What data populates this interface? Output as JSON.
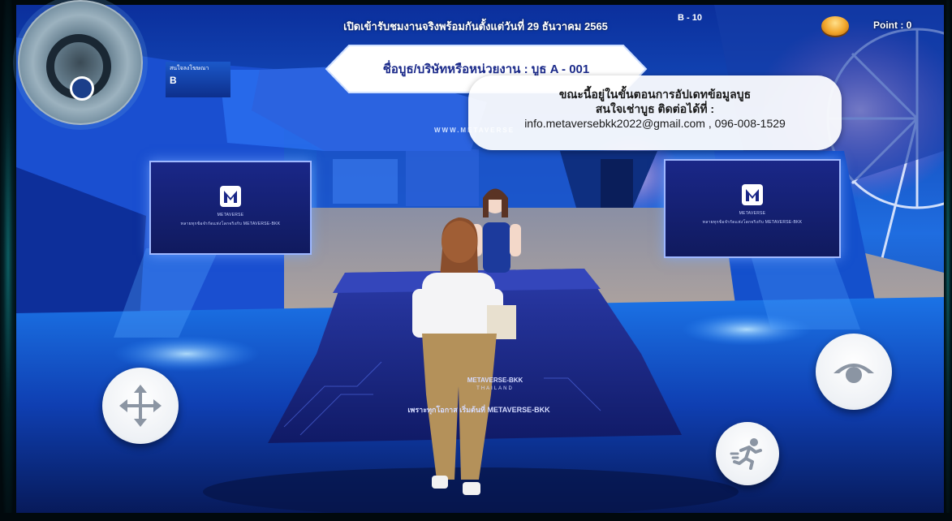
{
  "hud": {
    "top_banner": "เปิดเข้ารับชมงานจริงพร้อมกันตั้งแต่วันที่ 29 ธันวาคม 2565",
    "booth_name": "ชื่อบูธ/บริษัทหรือหน่วยงาน : บูธ A - 001",
    "notice_line1": "ขณะนี้อยู่ในขั้นตอนการอัปเดทข้อมูลบูธ",
    "notice_line2": "สนใจเช่าบูธ ติดต่อได้ที่ :",
    "notice_line3": "info.metaversebkk2022@gmail.com , 096-008-1529",
    "points_label": "Point : 0"
  },
  "scene": {
    "website_text": "WWW.METAVERSE",
    "side_sign_small": "สนใจลงโฆษณา",
    "side_sign_big": "B",
    "right_top_sign": "B - 10",
    "screen_caption_1": "METAVERSE",
    "screen_caption_2": "ทลายทุกข้อจำกัดแห่งโลกจริงกับ METAVERSE-BKK",
    "counter_brand": "METAVERSE-BKK",
    "counter_sub": "THAILAND",
    "counter_tagline": "เพราะทุกโอกาส เริ่มต้นที่ METAVERSE-BKK"
  },
  "controls": {
    "move_icon": "move-arrows-icon",
    "view_icon": "eye-icon",
    "run_icon": "running-person-icon"
  },
  "colors": {
    "accent_blue": "#1b2a8a",
    "sky_blue": "#2a8cff",
    "coin_gold": "#f2a52a",
    "frame_teal": "#0d5e63"
  }
}
